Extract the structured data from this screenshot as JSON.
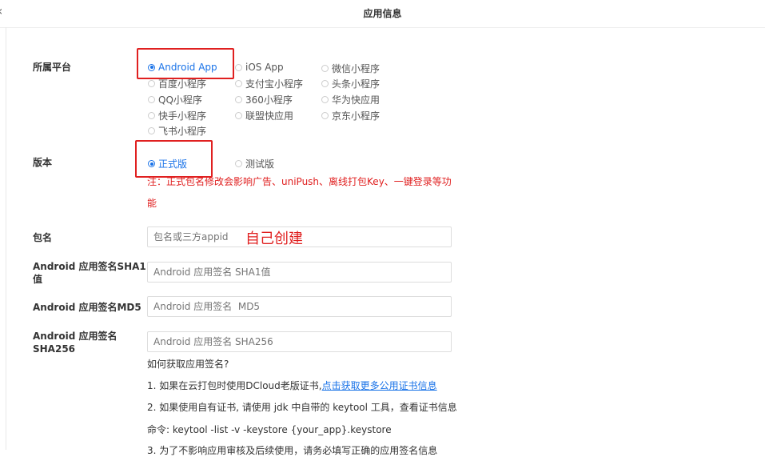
{
  "header": {
    "title": "应用信息",
    "back_glyph": "‹"
  },
  "platform": {
    "label": "所属平台",
    "options": [
      "Android App",
      "iOS App",
      "微信小程序",
      "百度小程序",
      "支付宝小程序",
      "头条小程序",
      "QQ小程序",
      "360小程序",
      "华为快应用",
      "快手小程序",
      "联盟快应用",
      "京东小程序",
      "飞书小程序"
    ],
    "selected": "Android App"
  },
  "version": {
    "label": "版本",
    "options": [
      "正式版",
      "测试版"
    ],
    "selected": "正式版",
    "note_line1": "注：正式包名修改会影响广告、uniPush、离线打包Key、一键登录等功",
    "note_line2": "能"
  },
  "package": {
    "label": "包名",
    "placeholder": "包名或三方appid",
    "annotation": "自己创建"
  },
  "sha1": {
    "label_line1": "Android 应用签名SHA1",
    "label_line2": "值",
    "placeholder": "Android 应用签名 SHA1值"
  },
  "md5": {
    "label": "Android 应用签名MD5",
    "placeholder": "Android 应用签名  MD5"
  },
  "sha256": {
    "label_line1": "Android 应用签名",
    "label_line2": "SHA256",
    "placeholder": "Android 应用签名 SHA256"
  },
  "help": {
    "title": "如何获取应用签名?",
    "line1_prefix": "1. 如果在云打包时使用DCloud老版证书,",
    "line1_link": "点击获取更多公用证书信息",
    "line2": "2. 如果使用自有证书, 请使用 jdk 中自带的 keytool 工具，查看证书信息",
    "line3": "命令: keytool -list -v -keystore {your_app}.keystore",
    "line4": "3. 为了不影响应用审核及后续使用，请务必填写正确的应用签名信息"
  },
  "colors": {
    "accent": "#1a73e8",
    "annotation_red": "#e02020"
  }
}
